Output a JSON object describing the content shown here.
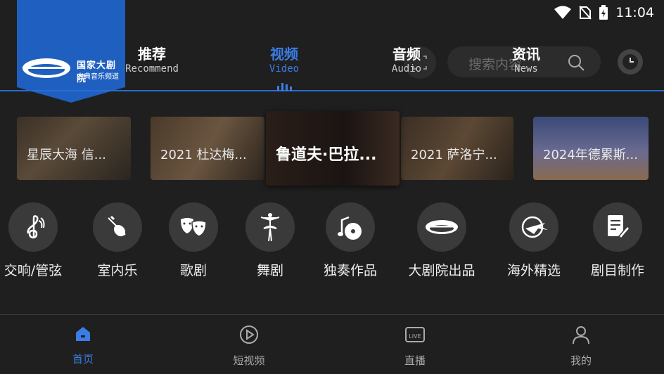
{
  "status": {
    "time": "11:04"
  },
  "logo": {
    "line1": "国家大剧院",
    "line2": "古典音乐频道"
  },
  "tabs": [
    {
      "zh": "推荐",
      "en": "Recommend"
    },
    {
      "zh": "视频",
      "en": "Video"
    },
    {
      "zh": "音频",
      "en": "Audio"
    },
    {
      "zh": "资讯",
      "en": "News"
    }
  ],
  "search": {
    "placeholder": "搜索内容"
  },
  "banners": [
    {
      "caption": "星辰大海 信..."
    },
    {
      "caption": "2021 杜达梅..."
    },
    {
      "caption": "鲁道夫·巴拉..."
    },
    {
      "caption": "2021 萨洛宁..."
    },
    {
      "caption": "2024年德累斯..."
    }
  ],
  "categories": [
    {
      "label": "交响/管弦",
      "icon": "treble-clef-icon"
    },
    {
      "label": "室内乐",
      "icon": "violin-icon"
    },
    {
      "label": "歌剧",
      "icon": "theater-masks-icon"
    },
    {
      "label": "舞剧",
      "icon": "ballerina-icon"
    },
    {
      "label": "独奏作品",
      "icon": "solo-note-icon"
    },
    {
      "label": "大剧院出品",
      "icon": "ncpa-logo-icon"
    },
    {
      "label": "海外精选",
      "icon": "globe-plane-icon"
    },
    {
      "label": "剧目制作",
      "icon": "edit-document-icon"
    }
  ],
  "bottom_nav": [
    {
      "label": "首页",
      "icon": "home-icon"
    },
    {
      "label": "短视频",
      "icon": "play-circle-icon"
    },
    {
      "label": "直播",
      "icon": "live-tv-icon"
    },
    {
      "label": "我的",
      "icon": "person-icon"
    }
  ],
  "colors": {
    "accent": "#3b7de6",
    "background": "#1f1f1f",
    "logo_blue": "#1f5fc0"
  }
}
